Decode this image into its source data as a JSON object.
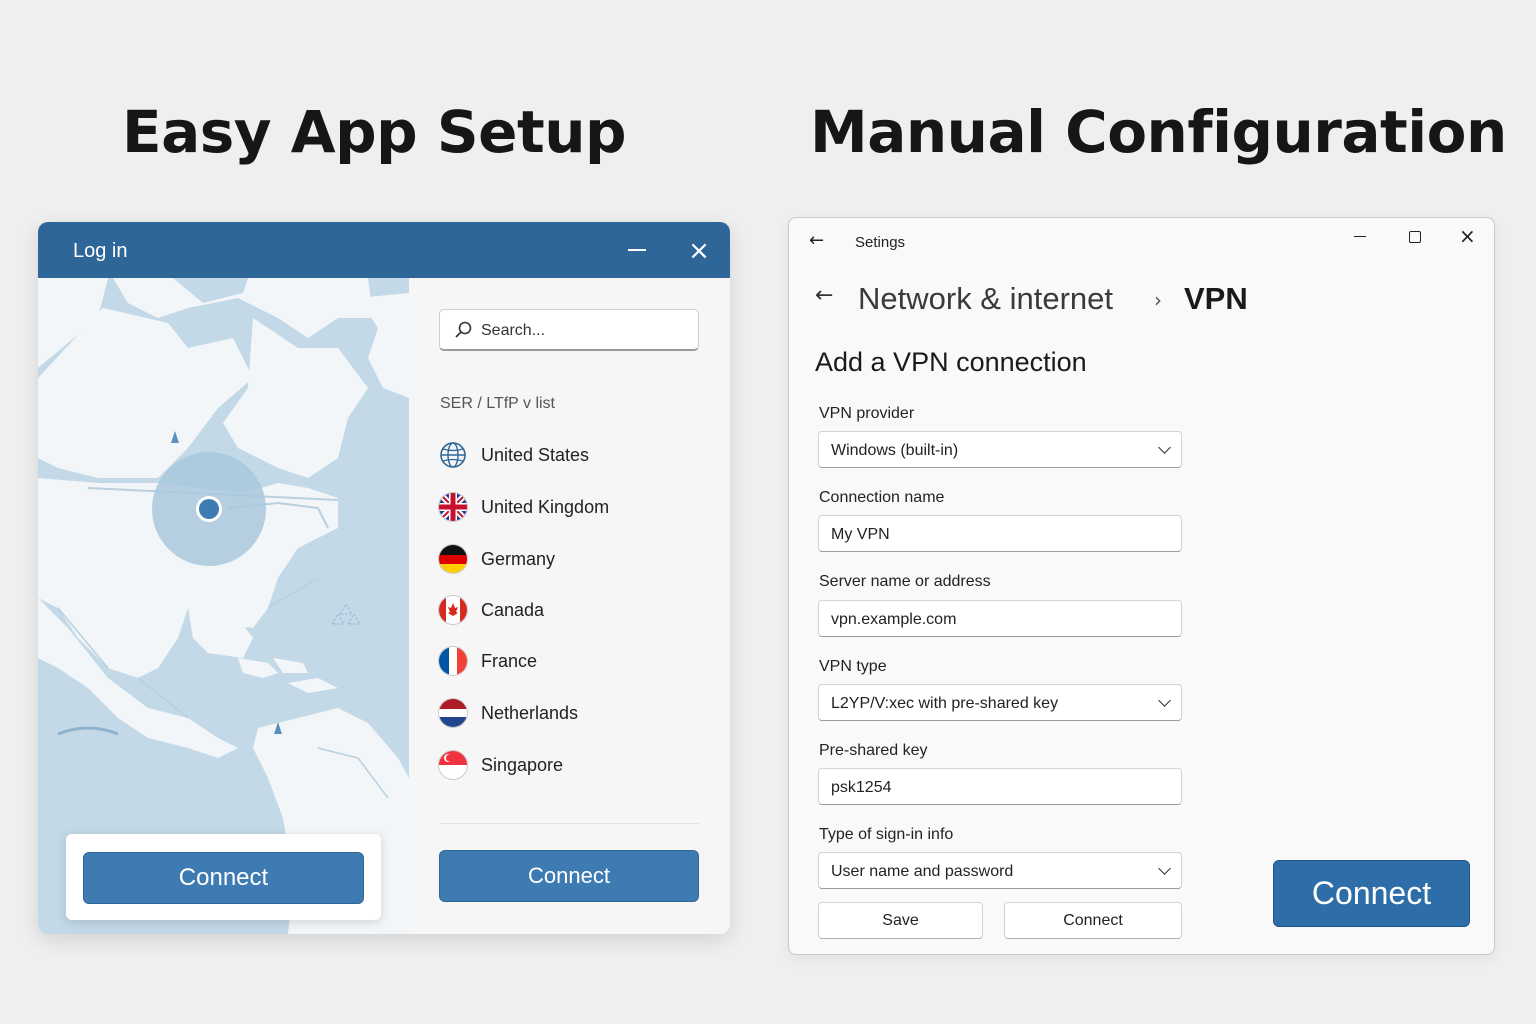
{
  "headings": {
    "left": "Easy App Setup",
    "right": "Manual Configuration"
  },
  "app": {
    "title": "Log in",
    "search_placeholder": "Search...",
    "list_header": "SER / LTfP v list",
    "countries": [
      {
        "name": "United States",
        "flag": "globe-icon"
      },
      {
        "name": "United Kingdom",
        "flag": "uk-flag-icon"
      },
      {
        "name": "Germany",
        "flag": "germany-flag-icon"
      },
      {
        "name": "Canada",
        "flag": "canada-flag-icon"
      },
      {
        "name": "France",
        "flag": "france-flag-icon"
      },
      {
        "name": "Netherlands",
        "flag": "netherlands-flag-icon"
      },
      {
        "name": "Singapore",
        "flag": "singapore-flag-icon"
      }
    ],
    "connect_map_label": "Connect",
    "connect_panel_label": "Connect",
    "colors": {
      "titlebar": "#2e6797",
      "button": "#3f7bb3",
      "map_water": "#c3d9e7"
    }
  },
  "settings": {
    "window_title": "Setings",
    "breadcrumb": {
      "parent": "Network & internet",
      "current": "VPN"
    },
    "page_title": "Add a VPN connection",
    "fields": {
      "provider": {
        "label": "VPN provider",
        "value": "Windows (built-in)"
      },
      "connection_name": {
        "label": "Connection name",
        "value": "My VPN"
      },
      "server": {
        "label": "Server name or address",
        "value": "vpn.example.com"
      },
      "vpn_type": {
        "label": "VPN type",
        "value": "L2YP/V:xec with pre-shared key"
      },
      "psk": {
        "label": "Pre-shared key",
        "value": "psk1254"
      },
      "signin": {
        "label": "Type of sign-in info",
        "value": "User name and password"
      }
    },
    "save_label": "Save",
    "connect_label": "Connect",
    "connect_accent_label": "Connect",
    "colors": {
      "accent": "#2e6ea8"
    }
  }
}
